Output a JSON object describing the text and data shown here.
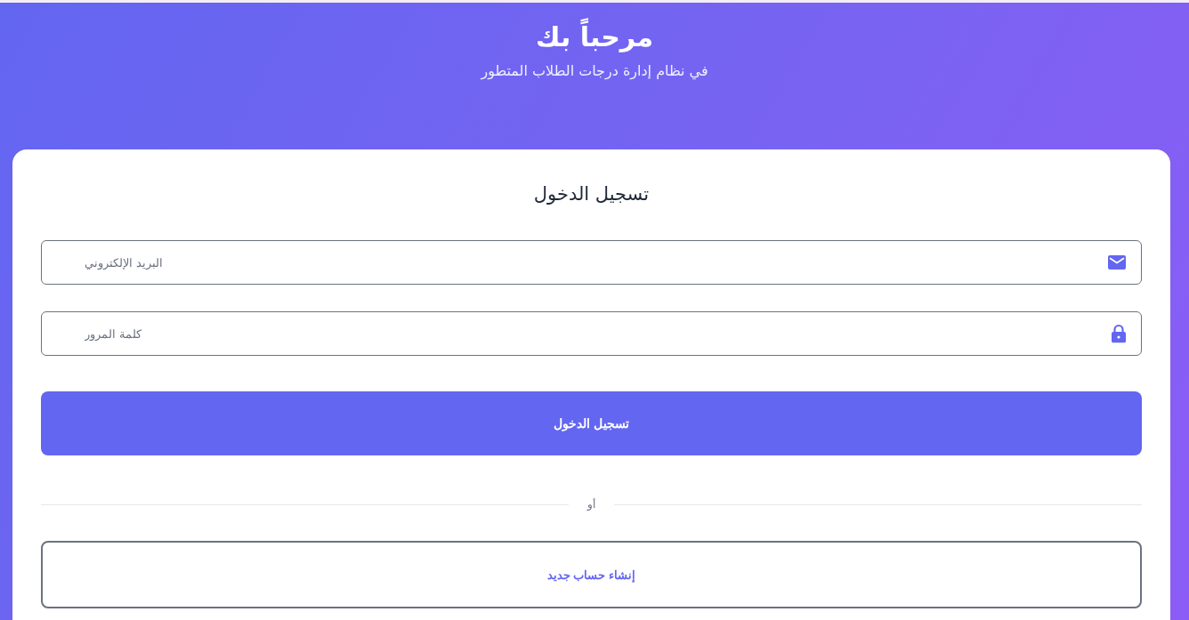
{
  "header": {
    "title": "مرحباً بك",
    "subtitle": "في نظام إدارة درجات الطلاب المتطور"
  },
  "login_card": {
    "title": "تسجيل الدخول",
    "fields": [
      {
        "kind": "email",
        "placeholder": "البريد الإلكتروني"
      },
      {
        "kind": "password",
        "placeholder": "كلمة المرور"
      }
    ],
    "submit_button": "تسجيل الدخول",
    "divider": "أو",
    "register_button": "إنشاء حساب جديد"
  }
}
